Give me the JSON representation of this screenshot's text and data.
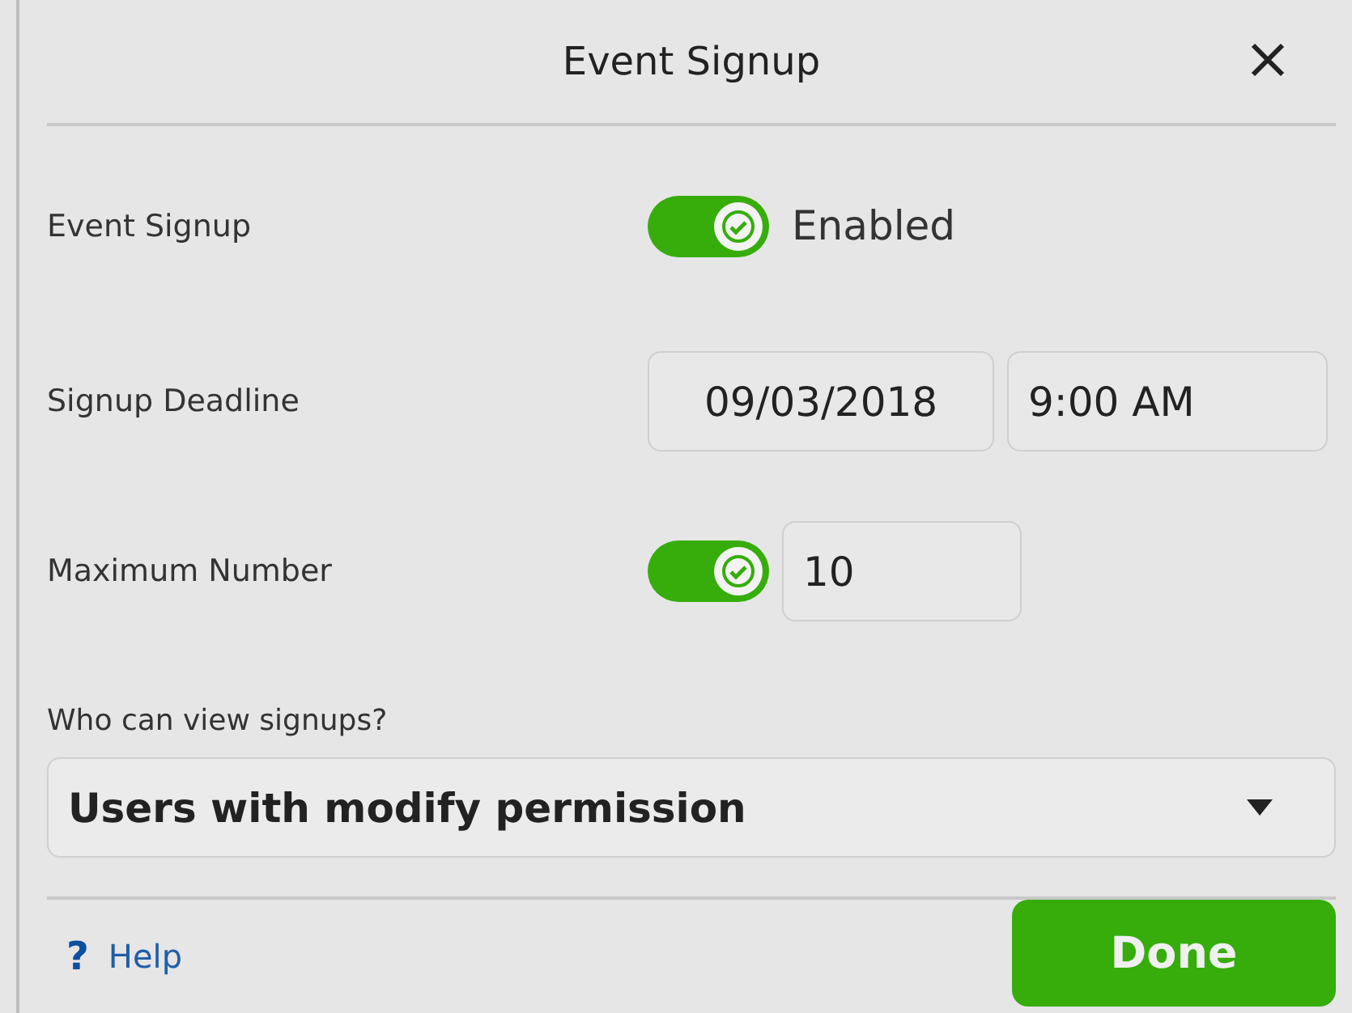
{
  "dialog": {
    "title": "Event Signup"
  },
  "rows": [
    {
      "kind": "toggle",
      "label": "Event Signup",
      "on": true,
      "text": "Enabled"
    },
    {
      "kind": "datetime",
      "label": "Signup Deadline",
      "date": "09/03/2018",
      "time": "9:00 AM"
    },
    {
      "kind": "toggle-number",
      "label": "Maximum Number",
      "on": true,
      "value": "10"
    }
  ],
  "visibility": {
    "label": "Who can view signups?",
    "value": "Users with modify permission"
  },
  "footer": {
    "help_icon": "?",
    "help": "Help",
    "done": "Done"
  }
}
